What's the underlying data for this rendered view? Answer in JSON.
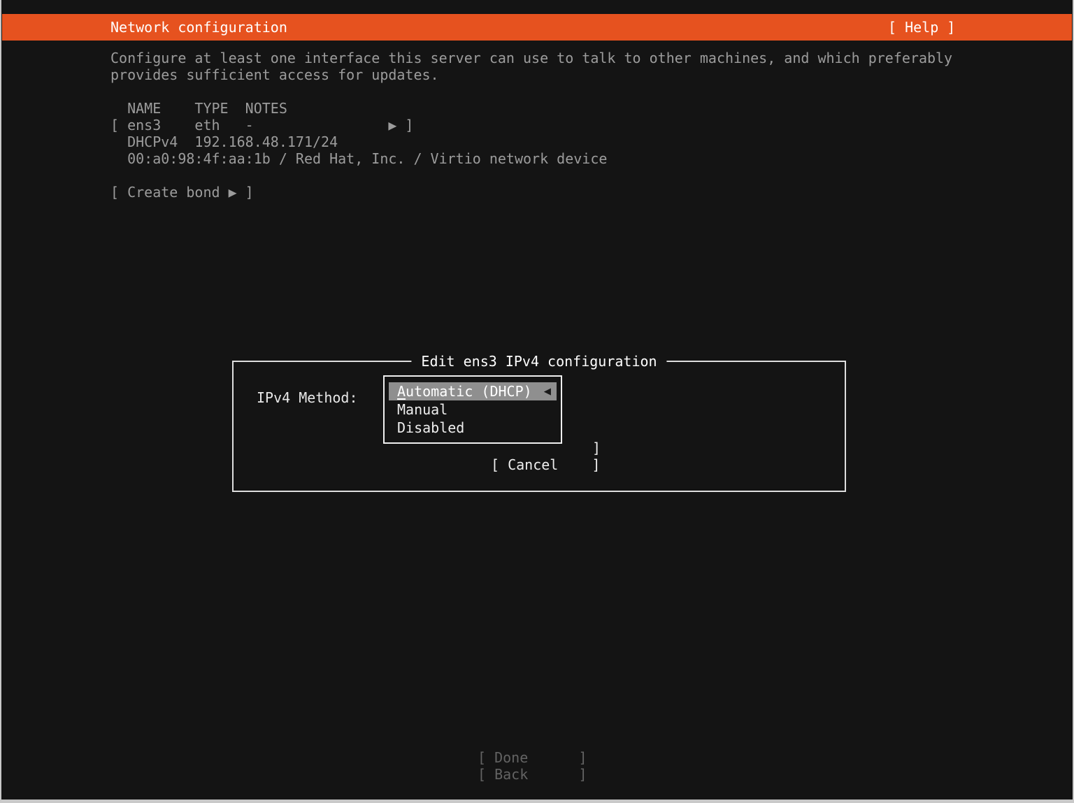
{
  "header": {
    "title": "Network configuration",
    "help_button": "[ Help ]"
  },
  "intro": {
    "line1": "Configure at least one interface this server can use to talk to other machines, and which preferably",
    "line2": "provides sufficient access for updates."
  },
  "interfaces": {
    "columns_row": "  NAME    TYPE  NOTES",
    "device_row": "[ ens3    eth   -                ▶ ]",
    "dhcp_row": "  DHCPv4  192.168.48.171/24",
    "hw_row": "  00:a0:98:4f:aa:1b / Red Hat, Inc. / Virtio network device",
    "create_bond_button": "[ Create bond ▶ ]"
  },
  "dialog": {
    "title": "Edit ens3 IPv4 configuration",
    "field_label": "IPv4 Method:",
    "dropdown": {
      "selected_hotkey": "A",
      "selected_rest": "utomatic (DHCP)",
      "selected_arrow": "◀",
      "option2": "Manual",
      "option3": "Disabled"
    },
    "save_bracket": "]",
    "cancel_button": "[ Cancel    ]"
  },
  "footer": {
    "done_button": "[ Done      ]",
    "back_button": "[ Back      ]"
  },
  "colors": {
    "background": "#141414",
    "accent_orange": "#e6521f",
    "dim_text": "#9c9c9c",
    "bright_text": "#eeeeee",
    "disabled_text": "#636363",
    "highlight_bg": "#8f8f8f",
    "frame": "#c9c9c9"
  }
}
